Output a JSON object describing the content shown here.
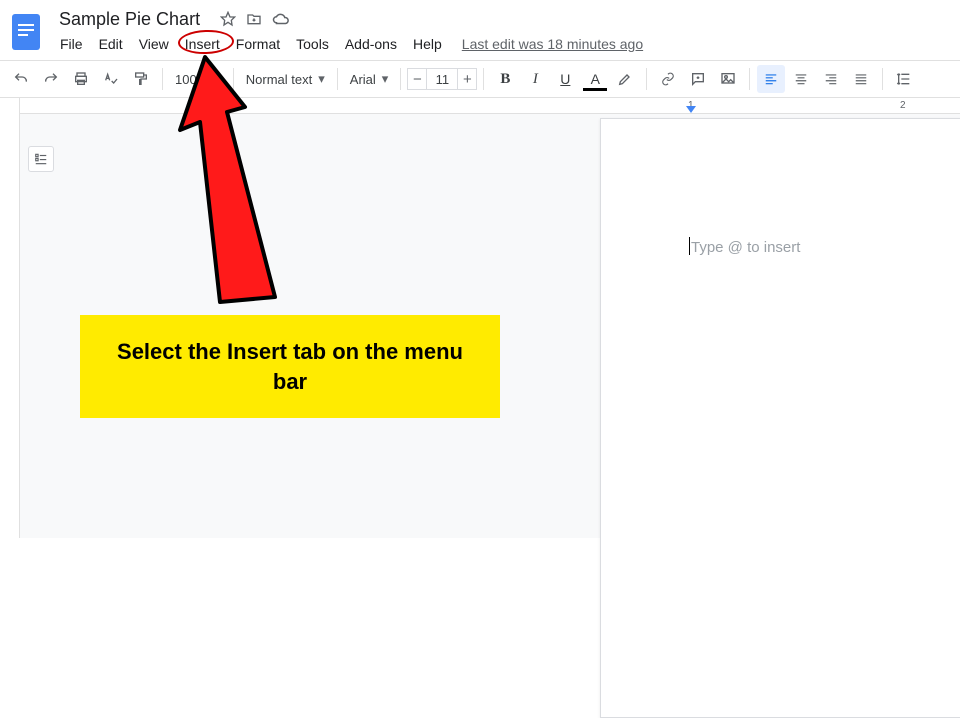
{
  "doc": {
    "title": "Sample Pie Chart",
    "last_edit": "Last edit was 18 minutes ago"
  },
  "menus": {
    "file": "File",
    "edit": "Edit",
    "view": "View",
    "insert": "Insert",
    "format": "Format",
    "tools": "Tools",
    "addons": "Add-ons",
    "help": "Help"
  },
  "toolbar": {
    "zoom": "100%",
    "style": "Normal text",
    "font": "Arial",
    "font_size": "11",
    "minus": "−",
    "plus": "+",
    "bold": "B",
    "italic": "I",
    "underline": "U",
    "textcolor": "A"
  },
  "ruler": {
    "n1": "1",
    "n2": "2"
  },
  "page": {
    "placeholder": "Type @ to insert"
  },
  "annotation": {
    "callout": "Select the Insert tab on the menu bar"
  }
}
